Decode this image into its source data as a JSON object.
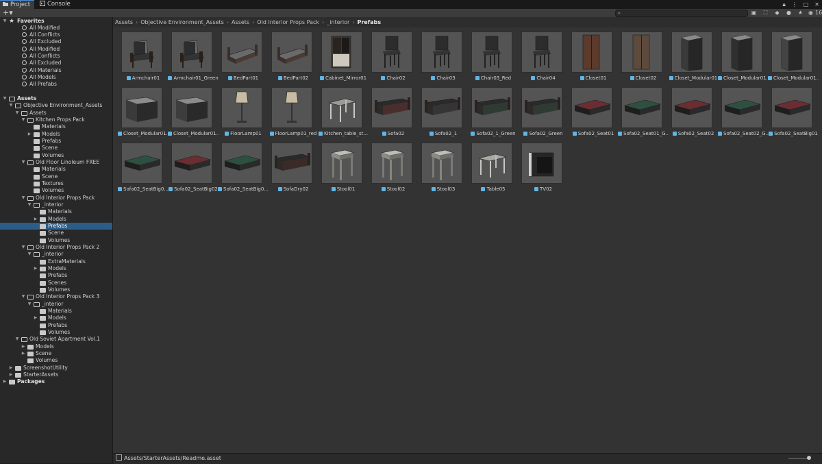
{
  "tabs": [
    {
      "label": "Project",
      "icon": "folder-icon",
      "active": true
    },
    {
      "label": "Console",
      "icon": "console-icon",
      "active": false
    }
  ],
  "toolbar": {
    "add_label": "+▾",
    "search_value": "",
    "hidden_count": "16"
  },
  "breadcrumb": [
    "Assets",
    "Objective Environment_Assets",
    "Assets",
    "Old Interior Props Pack",
    "_interior",
    "Prefabs"
  ],
  "tree": [
    {
      "label": "Favorites",
      "depth": 0,
      "kind": "star",
      "expand": "open",
      "header": true
    },
    {
      "label": "All Modified",
      "depth": 2,
      "kind": "search"
    },
    {
      "label": "All Conflicts",
      "depth": 2,
      "kind": "search"
    },
    {
      "label": "All Excluded",
      "depth": 2,
      "kind": "search"
    },
    {
      "label": "All Modified",
      "depth": 2,
      "kind": "search"
    },
    {
      "label": "All Conflicts",
      "depth": 2,
      "kind": "search"
    },
    {
      "label": "All Excluded",
      "depth": 2,
      "kind": "search"
    },
    {
      "label": "All Materials",
      "depth": 2,
      "kind": "search"
    },
    {
      "label": "All Models",
      "depth": 2,
      "kind": "search"
    },
    {
      "label": "All Prefabs",
      "depth": 2,
      "kind": "search"
    },
    {
      "label": "",
      "depth": 0,
      "kind": "spacer"
    },
    {
      "label": "Assets",
      "depth": 0,
      "kind": "folder-open",
      "expand": "open",
      "header": true
    },
    {
      "label": "Objective Environment_Assets",
      "depth": 1,
      "kind": "folder-open",
      "expand": "open"
    },
    {
      "label": "Assets",
      "depth": 2,
      "kind": "folder-open",
      "expand": "open"
    },
    {
      "label": "Kitchen Props Pack",
      "depth": 3,
      "kind": "folder-open",
      "expand": "open"
    },
    {
      "label": "Materials",
      "depth": 4,
      "kind": "folder"
    },
    {
      "label": "Models",
      "depth": 4,
      "kind": "folder",
      "expand": "closed"
    },
    {
      "label": "Prefabs",
      "depth": 4,
      "kind": "folder"
    },
    {
      "label": "Scene",
      "depth": 4,
      "kind": "folder"
    },
    {
      "label": "Volumes",
      "depth": 4,
      "kind": "folder"
    },
    {
      "label": "Old Floor Linoleum FREE",
      "depth": 3,
      "kind": "folder-open",
      "expand": "open"
    },
    {
      "label": "Materials",
      "depth": 4,
      "kind": "folder"
    },
    {
      "label": "Scene",
      "depth": 4,
      "kind": "folder"
    },
    {
      "label": "Textures",
      "depth": 4,
      "kind": "folder"
    },
    {
      "label": "Volumes",
      "depth": 4,
      "kind": "folder"
    },
    {
      "label": "Old Interior Props Pack",
      "depth": 3,
      "kind": "folder-open",
      "expand": "open"
    },
    {
      "label": "_interior",
      "depth": 4,
      "kind": "folder-open",
      "expand": "open"
    },
    {
      "label": "Materials",
      "depth": 5,
      "kind": "folder"
    },
    {
      "label": "Models",
      "depth": 5,
      "kind": "folder",
      "expand": "closed"
    },
    {
      "label": "Prefabs",
      "depth": 5,
      "kind": "folder",
      "selected": true
    },
    {
      "label": "Scene",
      "depth": 5,
      "kind": "folder"
    },
    {
      "label": "Volumes",
      "depth": 5,
      "kind": "folder"
    },
    {
      "label": "Old Interior Props Pack 2",
      "depth": 3,
      "kind": "folder-open",
      "expand": "open"
    },
    {
      "label": "_interior",
      "depth": 4,
      "kind": "folder-open",
      "expand": "open"
    },
    {
      "label": "ExtraMaterials",
      "depth": 5,
      "kind": "folder"
    },
    {
      "label": "Models",
      "depth": 5,
      "kind": "folder",
      "expand": "closed"
    },
    {
      "label": "Prefabs",
      "depth": 5,
      "kind": "folder"
    },
    {
      "label": "Scenes",
      "depth": 5,
      "kind": "folder"
    },
    {
      "label": "Volumes",
      "depth": 5,
      "kind": "folder"
    },
    {
      "label": "Old Interior Props Pack 3",
      "depth": 3,
      "kind": "folder-open",
      "expand": "open"
    },
    {
      "label": "_interior",
      "depth": 4,
      "kind": "folder-open",
      "expand": "open"
    },
    {
      "label": "Materials",
      "depth": 5,
      "kind": "folder"
    },
    {
      "label": "Models",
      "depth": 5,
      "kind": "folder",
      "expand": "closed"
    },
    {
      "label": "Prefabs",
      "depth": 5,
      "kind": "folder"
    },
    {
      "label": "Volumes",
      "depth": 5,
      "kind": "folder"
    },
    {
      "label": "Old Soviet Apartment Vol.1",
      "depth": 2,
      "kind": "folder-open",
      "expand": "open"
    },
    {
      "label": "Models",
      "depth": 3,
      "kind": "folder",
      "expand": "closed"
    },
    {
      "label": "Scene",
      "depth": 3,
      "kind": "folder",
      "expand": "closed"
    },
    {
      "label": "Volumes",
      "depth": 3,
      "kind": "folder"
    },
    {
      "label": "ScreenshotUtility",
      "depth": 1,
      "kind": "folder",
      "expand": "closed"
    },
    {
      "label": "StarterAssets",
      "depth": 1,
      "kind": "folder",
      "expand": "closed"
    },
    {
      "label": "Packages",
      "depth": 0,
      "kind": "folder",
      "expand": "closed",
      "header": true
    }
  ],
  "assets": [
    {
      "label": "Armchair01",
      "shape": "armchair",
      "color": "#6b6b6b"
    },
    {
      "label": "Armchair01_Green",
      "shape": "armchair",
      "color": "#6b6b6b"
    },
    {
      "label": "BedPart01",
      "shape": "bed",
      "color": "#5a5a5a"
    },
    {
      "label": "BedPart02",
      "shape": "bed",
      "color": "#5a5a5a"
    },
    {
      "label": "Cabinet_Mirror01",
      "shape": "cabinet",
      "color": "#3e3630"
    },
    {
      "label": "Chair02",
      "shape": "chair",
      "color": "#2c2c2c"
    },
    {
      "label": "Chair03",
      "shape": "chair",
      "color": "#2c2c2c"
    },
    {
      "label": "Chair03_Red",
      "shape": "chair",
      "color": "#2c2c2c"
    },
    {
      "label": "Chair04",
      "shape": "chair",
      "color": "#2c2c2c"
    },
    {
      "label": "Closet01",
      "shape": "closet",
      "color": "#5c3a2c"
    },
    {
      "label": "Closet02",
      "shape": "closet",
      "color": "#5e4a3c"
    },
    {
      "label": "Closet_Modular01",
      "shape": "tallbox",
      "color": "#3a3a3a"
    },
    {
      "label": "Closet_Modular01...",
      "shape": "tallbox",
      "color": "#2f2f2f"
    },
    {
      "label": "Closet_Modular01...",
      "shape": "tallbox",
      "color": "#444444"
    },
    {
      "label": "Closet_Modular01...",
      "shape": "box",
      "color": "#3a3a3a"
    },
    {
      "label": "Closet_Modular01...",
      "shape": "box",
      "color": "#3d3d3d"
    },
    {
      "label": "FloorLamp01",
      "shape": "lamp",
      "color": "#8a8070"
    },
    {
      "label": "FloorLamp01_red",
      "shape": "lamp",
      "color": "#8a7a74"
    },
    {
      "label": "Kitchen_table_st...",
      "shape": "table",
      "color": "#9a9a98"
    },
    {
      "label": "Sofa02",
      "shape": "sofa",
      "color": "#4a2e2e"
    },
    {
      "label": "Sofa02_1",
      "shape": "sofa",
      "color": "#353535"
    },
    {
      "label": "Sofa02_1_Green",
      "shape": "sofa",
      "color": "#2e3a32"
    },
    {
      "label": "Sofa02_Green",
      "shape": "sofa",
      "color": "#2e3a32"
    },
    {
      "label": "Sofa02_Seat01",
      "shape": "cushion",
      "color": "#6a2e32"
    },
    {
      "label": "Sofa02_Seat01_G...",
      "shape": "cushion",
      "color": "#2e5040"
    },
    {
      "label": "Sofa02_Seat02",
      "shape": "cushion",
      "color": "#6a2e32"
    },
    {
      "label": "Sofa02_Seat02_G...",
      "shape": "cushion",
      "color": "#2e5040"
    },
    {
      "label": "Sofa02_SeatBig01",
      "shape": "cushion",
      "color": "#6a2e32"
    },
    {
      "label": "Sofa02_SeatBig0...",
      "shape": "cushion",
      "color": "#2e5040"
    },
    {
      "label": "Sofa02_SeatBig02",
      "shape": "cushion",
      "color": "#6a2e32"
    },
    {
      "label": "Sofa02_SeatBig0...",
      "shape": "cushion",
      "color": "#2e5040"
    },
    {
      "label": "SofaDry02",
      "shape": "sofa",
      "color": "#3a2a28"
    },
    {
      "label": "Stool01",
      "shape": "stool",
      "color": "#8a8a86"
    },
    {
      "label": "Stool02",
      "shape": "stool",
      "color": "#8a8a86"
    },
    {
      "label": "Stool03",
      "shape": "stool",
      "color": "#8a8a86"
    },
    {
      "label": "Table05",
      "shape": "table",
      "color": "#a8a8a4"
    },
    {
      "label": "TV02",
      "shape": "tv",
      "color": "#262626"
    }
  ],
  "status": {
    "path": "Assets/StarterAssets/Readme.asset",
    "zoom": 0.95
  }
}
